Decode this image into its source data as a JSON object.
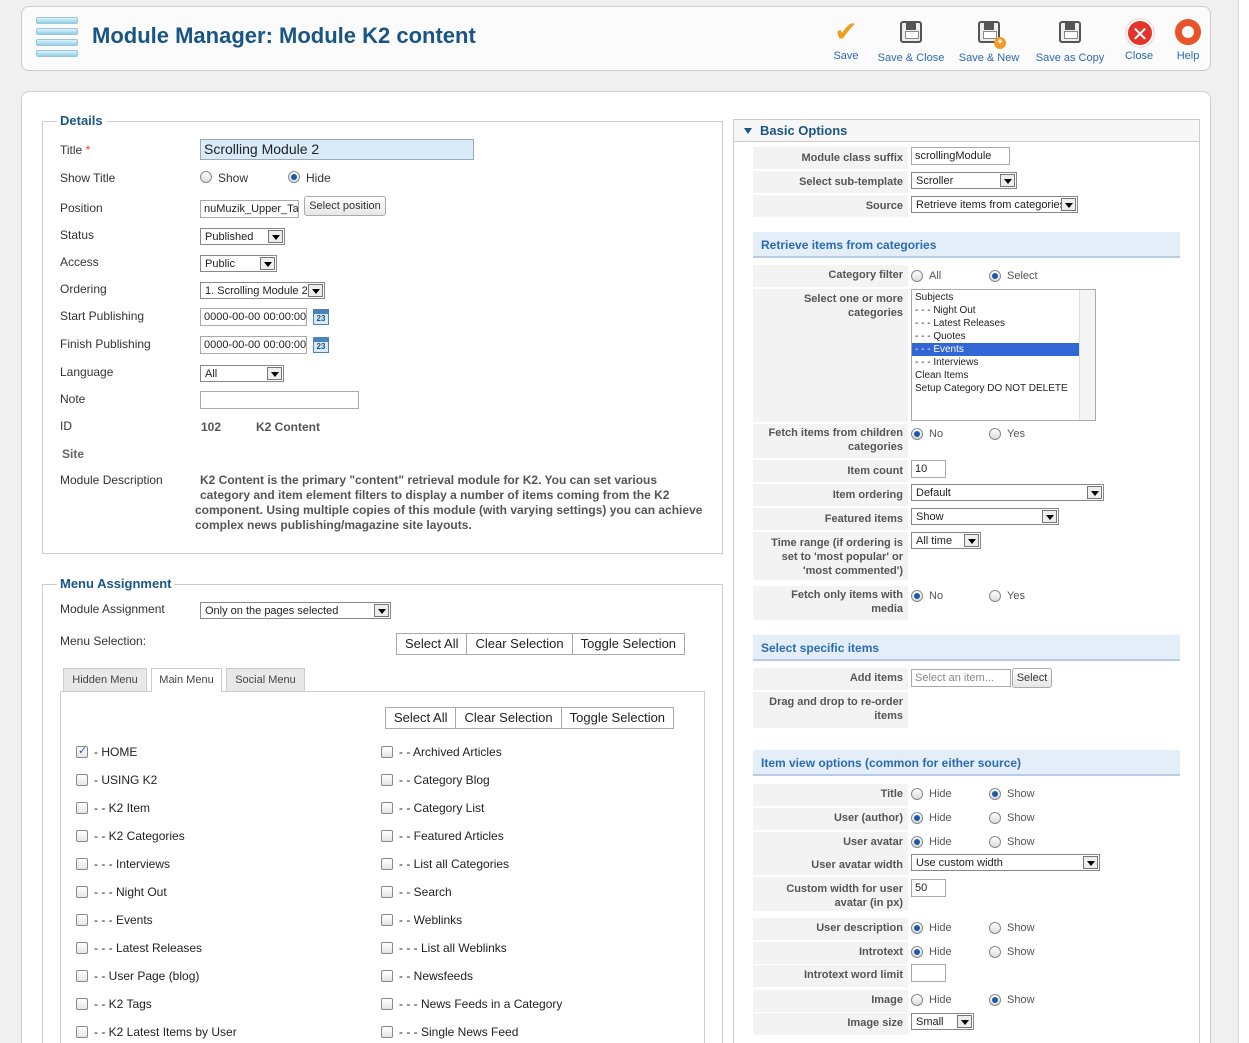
{
  "toolbar": {
    "title": "Module Manager: Module K2 content",
    "buttons": [
      "Save",
      "Save & Close",
      "Save & New",
      "Save as Copy",
      "Close",
      "Help"
    ]
  },
  "details": {
    "legend": "Details",
    "title_label": "Title",
    "title_required": "*",
    "title_value": "Scrolling Module 2",
    "show_title_label": "Show Title",
    "show_option": "Show",
    "hide_option": "Hide",
    "position_label": "Position",
    "position_value": "nuMuzik_Upper_Tab",
    "select_position": "Select position",
    "status_label": "Status",
    "status_value": "Published",
    "access_label": "Access",
    "access_value": "Public",
    "ordering_label": "Ordering",
    "ordering_value": "1. Scrolling Module 2",
    "start_label": "Start Publishing",
    "start_value": "0000-00-00 00:00:00",
    "finish_label": "Finish Publishing",
    "finish_value": "0000-00-00 00:00:00",
    "cal_icon": "23",
    "language_label": "Language",
    "language_value": "All",
    "note_label": "Note",
    "note_value": "",
    "id_label": "ID",
    "id_value": "102",
    "module_type": "K2 Content",
    "site_label": "Site",
    "desc_label": "Module Description",
    "desc_line1": "K2 Content is the primary \"content\" retrieval module for K2. You can set various",
    "desc_line2": "category and item element filters to display a number of items coming from the K2",
    "desc_line3": "component. Using multiple copies of this module (with varying settings) you can achieve",
    "desc_line4": "complex news publishing/magazine site layouts."
  },
  "menu_assignment": {
    "legend": "Menu Assignment",
    "assignment_label": "Module Assignment",
    "assignment_value": "Only on the pages selected",
    "selection_label": "Menu Selection:",
    "group_buttons": [
      "Select All",
      "Clear Selection",
      "Toggle Selection"
    ],
    "tabs": [
      "Hidden Menu",
      "Main Menu",
      "Social Menu"
    ],
    "left_items": [
      "- HOME",
      "- USING K2",
      "- - K2 Item",
      "- - K2 Categories",
      "- - - Interviews",
      "- - - Night Out",
      "- - - Events",
      "- - - Latest Releases",
      "- - User Page (blog)",
      "- - K2 Tags",
      "- - K2 Latest Items by User"
    ],
    "right_items": [
      "- - Archived Articles",
      "- - Category Blog",
      "- - Category List",
      "- - Featured Articles",
      "- - List all Categories",
      "- - Search",
      "- - Weblinks",
      "- - - List all Weblinks",
      "- - Newsfeeds",
      "- - - News Feeds in a Category",
      "- - - Single News Feed"
    ]
  },
  "basic_options": {
    "header": "Basic Options",
    "module_class_suffix_label": "Module class suffix",
    "module_class_suffix_value": "scrollingModule",
    "sub_template_label": "Select sub-template",
    "sub_template_value": "Scroller",
    "source_label": "Source",
    "source_value": "Retrieve items from categories",
    "retrieve_header": "Retrieve items from categories",
    "category_filter_label": "Category filter",
    "all_option": "All",
    "select_option": "Select",
    "categories_label_1": "Select one or more",
    "categories_label_2": "categories",
    "categories": [
      "Subjects",
      "- - - Night Out",
      "- - - Latest Releases",
      "- - - Quotes",
      "- - - Events",
      "- - - Interviews",
      "Clean Items",
      "Setup Category DO NOT DELETE"
    ],
    "fetch_children_label_1": "Fetch items from children",
    "fetch_children_label_2": "categories",
    "no_option": "No",
    "yes_option": "Yes",
    "item_count_label": "Item count",
    "item_count_value": "10",
    "item_ordering_label": "Item ordering",
    "item_ordering_value": "Default",
    "featured_label": "Featured items",
    "featured_value": "Show",
    "time_range_label_1": "Time range (if ordering is",
    "time_range_label_2": "set to 'most popular' or",
    "time_range_label_3": "'most commented')",
    "time_range_value": "All time",
    "fetch_media_label_1": "Fetch only items with",
    "fetch_media_label_2": "media",
    "specific_header": "Select specific items",
    "add_items_label": "Add items",
    "add_items_placeholder": "Select an item...",
    "select_button": "Select",
    "drag_label_1": "Drag and drop to re-order",
    "drag_label_2": "items",
    "view_header": "Item view options (common for either source)",
    "hide_option": "Hide",
    "show_option": "Show",
    "title_label": "Title",
    "user_author_label": "User (author)",
    "user_avatar_label": "User avatar",
    "avatar_width_label": "User avatar width",
    "avatar_width_value": "Use custom width",
    "custom_width_label_1": "Custom width for user",
    "custom_width_label_2": "avatar (in px)",
    "custom_width_value": "50",
    "user_desc_label": "User description",
    "introtext_label": "Introtext",
    "introtext_limit_label": "Introtext word limit",
    "introtext_limit_value": "",
    "image_label": "Image",
    "image_size_label": "Image size",
    "image_size_value": "Small"
  }
}
